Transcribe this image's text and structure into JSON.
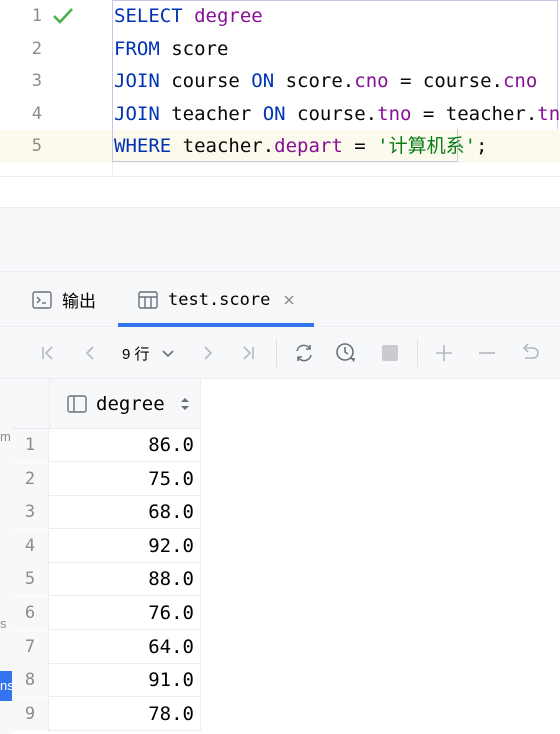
{
  "editor": {
    "line_numbers": [
      "1",
      "2",
      "3",
      "4",
      "5"
    ],
    "lines": [
      [
        {
          "t": "SELECT",
          "c": "kw"
        },
        {
          "t": " ",
          "c": ""
        },
        {
          "t": "degree",
          "c": "col"
        }
      ],
      [
        {
          "t": "FROM",
          "c": "kw"
        },
        {
          "t": " score",
          "c": ""
        }
      ],
      [
        {
          "t": "JOIN",
          "c": "kw"
        },
        {
          "t": " course ",
          "c": ""
        },
        {
          "t": "ON",
          "c": "kw"
        },
        {
          "t": " score.",
          "c": ""
        },
        {
          "t": "cno",
          "c": "col"
        },
        {
          "t": " = course.",
          "c": ""
        },
        {
          "t": "cno",
          "c": "col"
        }
      ],
      [
        {
          "t": "JOIN",
          "c": "kw"
        },
        {
          "t": " teacher ",
          "c": ""
        },
        {
          "t": "ON",
          "c": "kw"
        },
        {
          "t": " course.",
          "c": ""
        },
        {
          "t": "tno",
          "c": "col"
        },
        {
          "t": " = teacher.",
          "c": ""
        },
        {
          "t": "tno",
          "c": "col"
        }
      ],
      [
        {
          "t": "WHERE",
          "c": "kw"
        },
        {
          "t": " teacher.",
          "c": ""
        },
        {
          "t": "depart",
          "c": "col"
        },
        {
          "t": " = ",
          "c": ""
        },
        {
          "t": "'计算机系'",
          "c": "str"
        },
        {
          "t": ";",
          "c": ""
        }
      ]
    ],
    "status_icon": "checkmark-icon",
    "status_color": "#4caf50"
  },
  "tool_window": {
    "tabs": [
      {
        "label": "输出",
        "icon": "console-icon"
      },
      {
        "label": "test.score",
        "icon": "table-icon",
        "active": true,
        "closable": true
      }
    ],
    "rows_label": "9 行",
    "toolbar_icons": [
      "first-page-icon",
      "prev-page-icon",
      "next-page-icon",
      "last-page-icon",
      "refresh-icon",
      "history-icon",
      "stop-icon",
      "add-row-icon",
      "delete-row-icon",
      "revert-icon"
    ]
  },
  "grid": {
    "column": "degree",
    "rows": [
      {
        "n": "1",
        "v": "86.0"
      },
      {
        "n": "2",
        "v": "75.0"
      },
      {
        "n": "3",
        "v": "68.0"
      },
      {
        "n": "4",
        "v": "92.0"
      },
      {
        "n": "5",
        "v": "88.0"
      },
      {
        "n": "6",
        "v": "76.0"
      },
      {
        "n": "7",
        "v": "64.0"
      },
      {
        "n": "8",
        "v": "91.0"
      },
      {
        "n": "9",
        "v": "78.0"
      }
    ]
  },
  "left_strip": {
    "t1": "m",
    "t2": "s",
    "selected": "ns"
  },
  "colors": {
    "accent": "#3574f0",
    "keyword": "#0033b3",
    "column": "#871094",
    "string": "#067d17"
  }
}
